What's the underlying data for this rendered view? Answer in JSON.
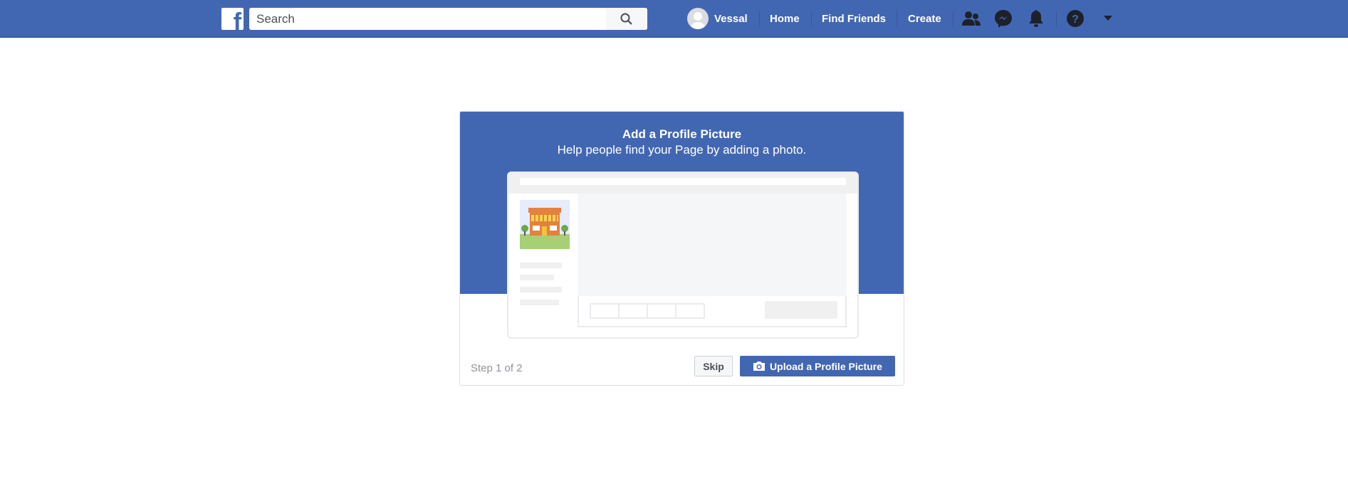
{
  "header": {
    "search": {
      "placeholder": "Search"
    },
    "user_name": "Vessal",
    "nav": [
      "Home",
      "Find Friends",
      "Create"
    ],
    "icons": [
      "friends-icon",
      "messenger-icon",
      "notifications-bell-icon",
      "help-icon",
      "caret-down-icon"
    ],
    "brand_color": "#4267b2"
  },
  "dialog": {
    "title": "Add a Profile Picture",
    "subtitle": "Help people find your Page by adding a photo.",
    "step": "Step 1 of 2",
    "skip_label": "Skip",
    "upload_label": "Upload a Profile Picture"
  }
}
